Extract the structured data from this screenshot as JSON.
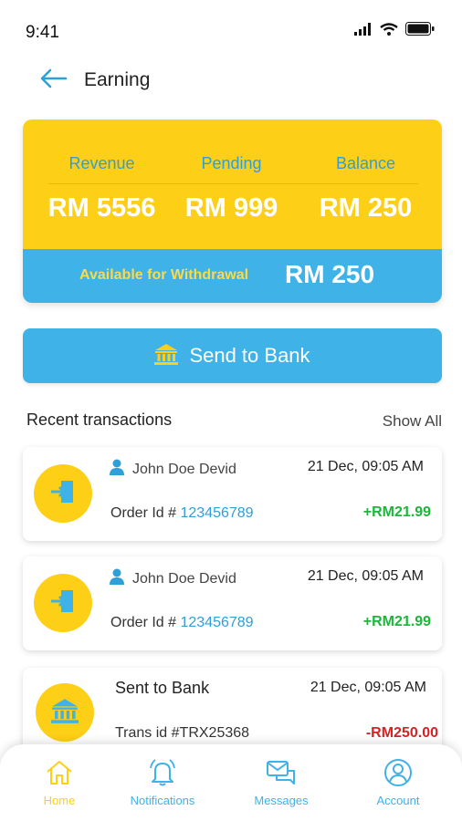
{
  "status_bar": {
    "time": "9:41"
  },
  "header": {
    "title": "Earning"
  },
  "earnings": {
    "revenue_label": "Revenue",
    "revenue_value": "RM 5556",
    "pending_label": "Pending",
    "pending_value": "RM 999",
    "balance_label": "Balance",
    "balance_value": "RM 250",
    "withdraw_label": "Available for Withdrawal",
    "withdraw_value": "RM 250"
  },
  "send_button": {
    "label": "Send to Bank",
    "icon": "bank-icon"
  },
  "recent": {
    "title": "Recent transactions",
    "show_all": "Show All",
    "transactions": [
      {
        "user": "John Doe Devid",
        "date": "21 Dec, 09:05 AM",
        "order_prefix": "Order Id # ",
        "order_id": "123456789",
        "amount": "+RM21.99",
        "icon": "sign-in-icon"
      },
      {
        "user": "John Doe Devid",
        "date": "21 Dec, 09:05 AM",
        "order_prefix": "Order Id # ",
        "order_id": "123456789",
        "amount": "+RM21.99",
        "icon": "sign-in-icon"
      },
      {
        "title": "Sent to Bank",
        "date": "21 Dec, 09:05 AM",
        "trans_id": "Trans id #TRX25368",
        "amount": "-RM250.00",
        "icon": "bank-icon"
      }
    ]
  },
  "nav": [
    {
      "label": "Home",
      "icon": "home-icon",
      "active": true
    },
    {
      "label": "Notifications",
      "icon": "bell-icon",
      "active": false
    },
    {
      "label": "Messages",
      "icon": "messages-icon",
      "active": false
    },
    {
      "label": "Account",
      "icon": "account-icon",
      "active": false
    }
  ],
  "colors": {
    "yellow": "#fdcf17",
    "blue": "#3fb2e8",
    "green": "#1fb53b",
    "red": "#d42424"
  }
}
